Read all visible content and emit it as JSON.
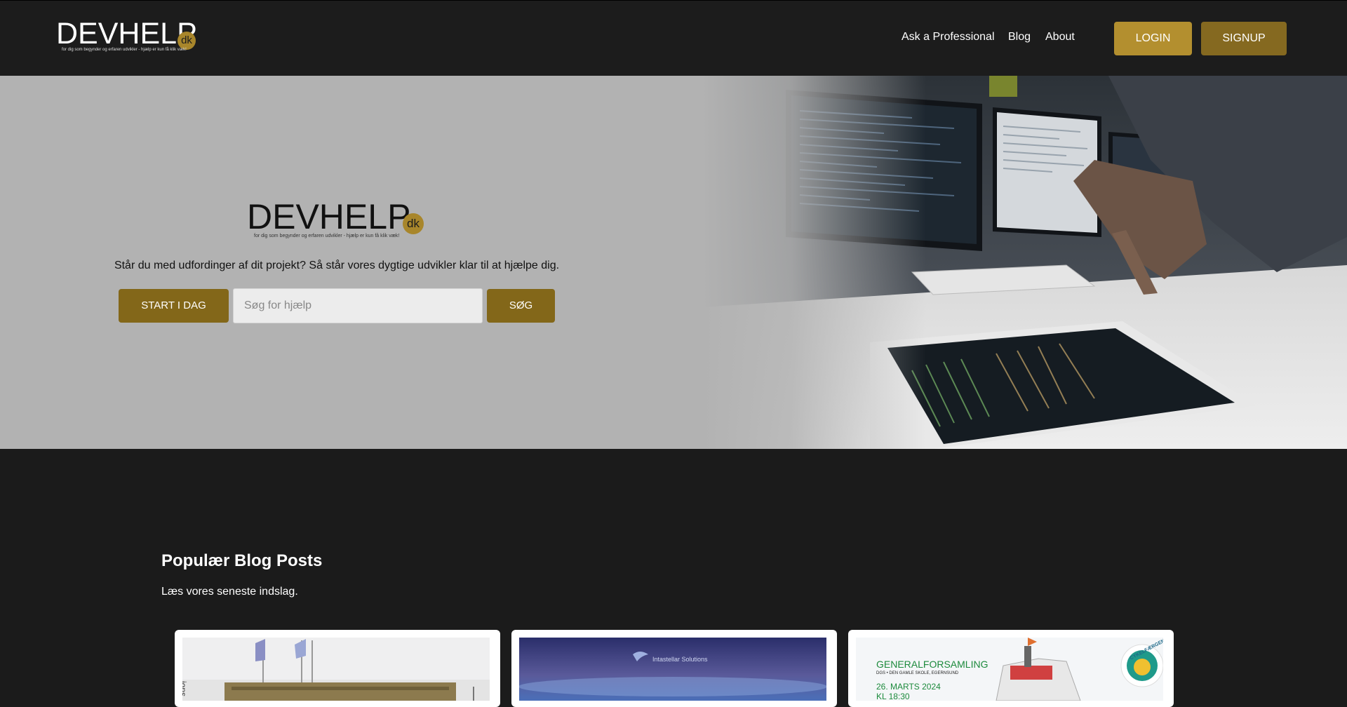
{
  "header": {
    "logo_text": "DEVHELP",
    "logo_badge": "dk",
    "logo_tagline": "for dig som begynder og erfaren udvikler - hjælp er kun få klik væk!",
    "nav": {
      "ask": "Ask a Professional",
      "blog": "Blog",
      "about": "About"
    },
    "login_label": "LOGIN",
    "signup_label": "SIGNUP"
  },
  "hero": {
    "logo_text": "DEVHELP",
    "logo_badge": "dk",
    "logo_tagline": "for dig som begynder og erfaren udvikler - hjælp er kun få klik væk!",
    "description": "Står du med udfordinger af dit projekt? Så står vores dygtige udvikler klar til at hjælpe dig.",
    "start_label": "START I DAG",
    "search_placeholder": "Søg for hjælp",
    "search_label": "SØG"
  },
  "blog": {
    "title": "Populær Blog Posts",
    "subtitle": "Læs vores seneste indslag.",
    "cards": [
      {
        "image_text": "ions"
      },
      {
        "image_text": "Intastellar Solutions"
      },
      {
        "headline": "GENERALFORSAMLING",
        "location": "DGS • DEN GAMLE SKOLE, EGERNSUND",
        "date": "26. MARTS 2024",
        "time": "KL 18:30",
        "badge": "CYKELFÆRGEN"
      }
    ]
  },
  "colors": {
    "gold": "#b38f2f",
    "dark_gold": "#836719",
    "header_bg": "#1c1c1c",
    "hero_bg": "#b2b2b2"
  }
}
